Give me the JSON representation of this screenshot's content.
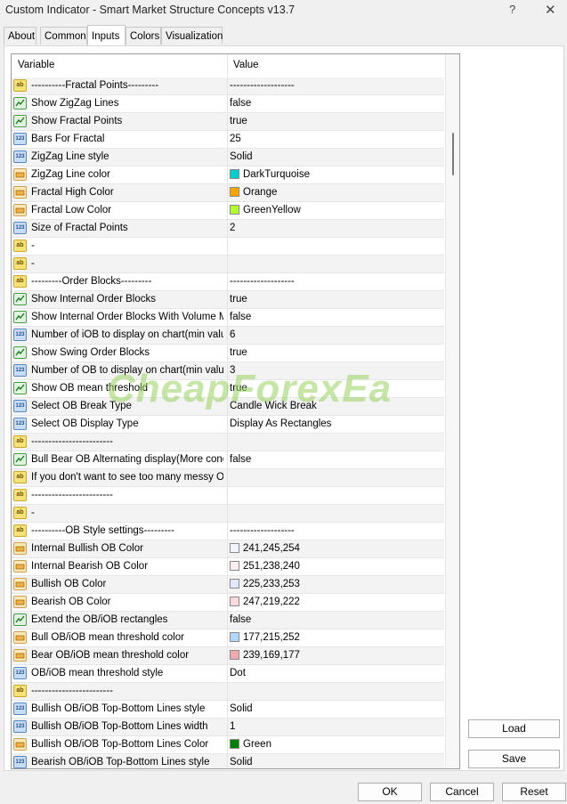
{
  "window": {
    "title": "Custom Indicator - Smart Market Structure Concepts v13.7",
    "help_glyph": "?",
    "close_glyph": "✕"
  },
  "tabs": [
    {
      "label": "About"
    },
    {
      "label": "Common"
    },
    {
      "label": "Inputs"
    },
    {
      "label": "Colors"
    },
    {
      "label": "Visualization"
    }
  ],
  "grid": {
    "headers": {
      "variable": "Variable",
      "value": "Value"
    },
    "rows": [
      {
        "icon": "ab",
        "name": "----------Fractal Points---------",
        "value": "-------------------"
      },
      {
        "icon": "bool",
        "name": "Show ZigZag Lines",
        "value": "false"
      },
      {
        "icon": "bool",
        "name": "Show Fractal Points",
        "value": "true"
      },
      {
        "icon": "num",
        "name": "Bars For Fractal",
        "value": "25"
      },
      {
        "icon": "num",
        "name": "ZigZag Line style",
        "value": "Solid"
      },
      {
        "icon": "col",
        "name": "ZigZag Line color",
        "value": "DarkTurquoise",
        "swatch": "#00ced1"
      },
      {
        "icon": "col",
        "name": "Fractal High Color",
        "value": "Orange",
        "swatch": "#ffa500"
      },
      {
        "icon": "col",
        "name": "Fractal Low Color",
        "value": "GreenYellow",
        "swatch": "#adff2f"
      },
      {
        "icon": "num",
        "name": "Size of Fractal Points",
        "value": "2"
      },
      {
        "icon": "ab",
        "name": "-",
        "value": ""
      },
      {
        "icon": "ab",
        "name": "-",
        "value": ""
      },
      {
        "icon": "ab",
        "name": "---------Order Blocks---------",
        "value": "-------------------"
      },
      {
        "icon": "bool",
        "name": "Show Internal Order Blocks",
        "value": "true"
      },
      {
        "icon": "bool",
        "name": "Show Internal Order Blocks With Volume M...",
        "value": "false"
      },
      {
        "icon": "num",
        "name": "Number of iOB to display on chart(min value...",
        "value": "6"
      },
      {
        "icon": "bool",
        "name": "Show Swing Order Blocks",
        "value": "true"
      },
      {
        "icon": "num",
        "name": "Number of OB to display on chart(min value 1)",
        "value": "3"
      },
      {
        "icon": "bool",
        "name": "Show OB mean threshold",
        "value": "true"
      },
      {
        "icon": "num",
        "name": "Select OB Break Type",
        "value": "Candle Wick Break"
      },
      {
        "icon": "num",
        "name": "Select OB Display Type",
        "value": "Display As Rectangles"
      },
      {
        "icon": "ab",
        "name": "------------------------",
        "value": ""
      },
      {
        "icon": "bool",
        "name": "Bull Bear OB Alternating display(More conci...",
        "value": "false"
      },
      {
        "icon": "ab",
        "name": "If you don't want to see too many messy OB...",
        "value": ""
      },
      {
        "icon": "ab",
        "name": "------------------------",
        "value": ""
      },
      {
        "icon": "ab",
        "name": "-",
        "value": ""
      },
      {
        "icon": "ab",
        "name": "----------OB Style settings---------",
        "value": "-------------------"
      },
      {
        "icon": "col",
        "name": "Internal Bullish OB Color",
        "value": "241,245,254",
        "swatch": "#f1f5fe"
      },
      {
        "icon": "col",
        "name": "Internal Bearish OB Color",
        "value": "251,238,240",
        "swatch": "#fbeef0"
      },
      {
        "icon": "col",
        "name": "Bullish OB Color",
        "value": "225,233,253",
        "swatch": "#e1e9fd"
      },
      {
        "icon": "col",
        "name": "Bearish OB Color",
        "value": "247,219,222",
        "swatch": "#f7dbde"
      },
      {
        "icon": "bool",
        "name": "Extend the OB/iOB rectangles",
        "value": "false"
      },
      {
        "icon": "col",
        "name": "Bull OB/iOB mean threshold color",
        "value": "177,215,252",
        "swatch": "#b1d7fc"
      },
      {
        "icon": "col",
        "name": "Bear OB/iOB mean threshold color",
        "value": "239,169,177",
        "swatch": "#efa9b1"
      },
      {
        "icon": "num",
        "name": "OB/iOB mean threshold style",
        "value": "Dot"
      },
      {
        "icon": "ab",
        "name": "------------------------",
        "value": ""
      },
      {
        "icon": "num",
        "name": "Bullish OB/iOB Top-Bottom Lines style",
        "value": "Solid"
      },
      {
        "icon": "num",
        "name": "Bullish OB/iOB Top-Bottom Lines width",
        "value": "1"
      },
      {
        "icon": "col",
        "name": "Bullish OB/iOB Top-Bottom Lines Color",
        "value": "Green",
        "swatch": "#008000"
      },
      {
        "icon": "num",
        "name": "Bearish OB/iOB Top-Bottom Lines style",
        "value": "Solid"
      }
    ]
  },
  "watermark": "CheapForexEa",
  "buttons": {
    "load": "Load",
    "save": "Save",
    "ok": "OK",
    "cancel": "Cancel",
    "reset": "Reset"
  }
}
